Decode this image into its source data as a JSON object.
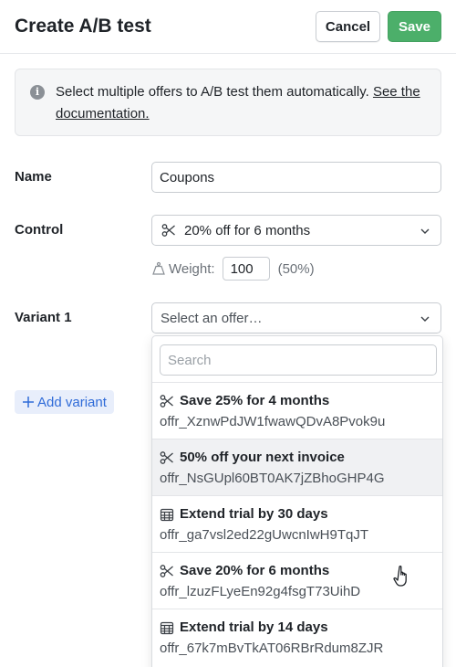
{
  "header": {
    "title": "Create A/B test",
    "cancel_label": "Cancel",
    "save_label": "Save"
  },
  "info": {
    "text": "Select multiple offers to A/B test them automatically.",
    "link": "See the documentation."
  },
  "form": {
    "name_label": "Name",
    "name_value": "Coupons",
    "control_label": "Control",
    "control_value": "20% off for 6 months",
    "weight_label": "Weight:",
    "weight_value": "100",
    "weight_percent": "(50%)",
    "variant_label": "Variant 1",
    "variant_placeholder": "Select an offer…",
    "add_variant_label": "Add variant"
  },
  "dropdown": {
    "search_placeholder": "Search",
    "options": [
      {
        "icon": "scissors-icon",
        "title": "Save 25% for 4 months",
        "id": "offr_XznwPdJW1fwawQDvA8Pvok9u"
      },
      {
        "icon": "scissors-icon",
        "title": "50% off your next invoice",
        "id": "offr_NsGUpl60BT0AK7jZBhoGHP4G"
      },
      {
        "icon": "calendar-icon",
        "title": "Extend trial by 30 days",
        "id": "offr_ga7vsl2ed22gUwcnIwH9TqJT"
      },
      {
        "icon": "scissors-icon",
        "title": "Save 20% for 6 months",
        "id": "offr_lzuzFLyeEn92g4fsgT73UihD"
      },
      {
        "icon": "calendar-icon",
        "title": "Extend trial by 14 days",
        "id": "offr_67k7mBvTkAT06RBrRdum8ZJR"
      }
    ]
  },
  "colors": {
    "save_button": "#4caf6a",
    "add_variant_text": "#2f6bd8",
    "add_variant_bg": "#e8eefb"
  }
}
